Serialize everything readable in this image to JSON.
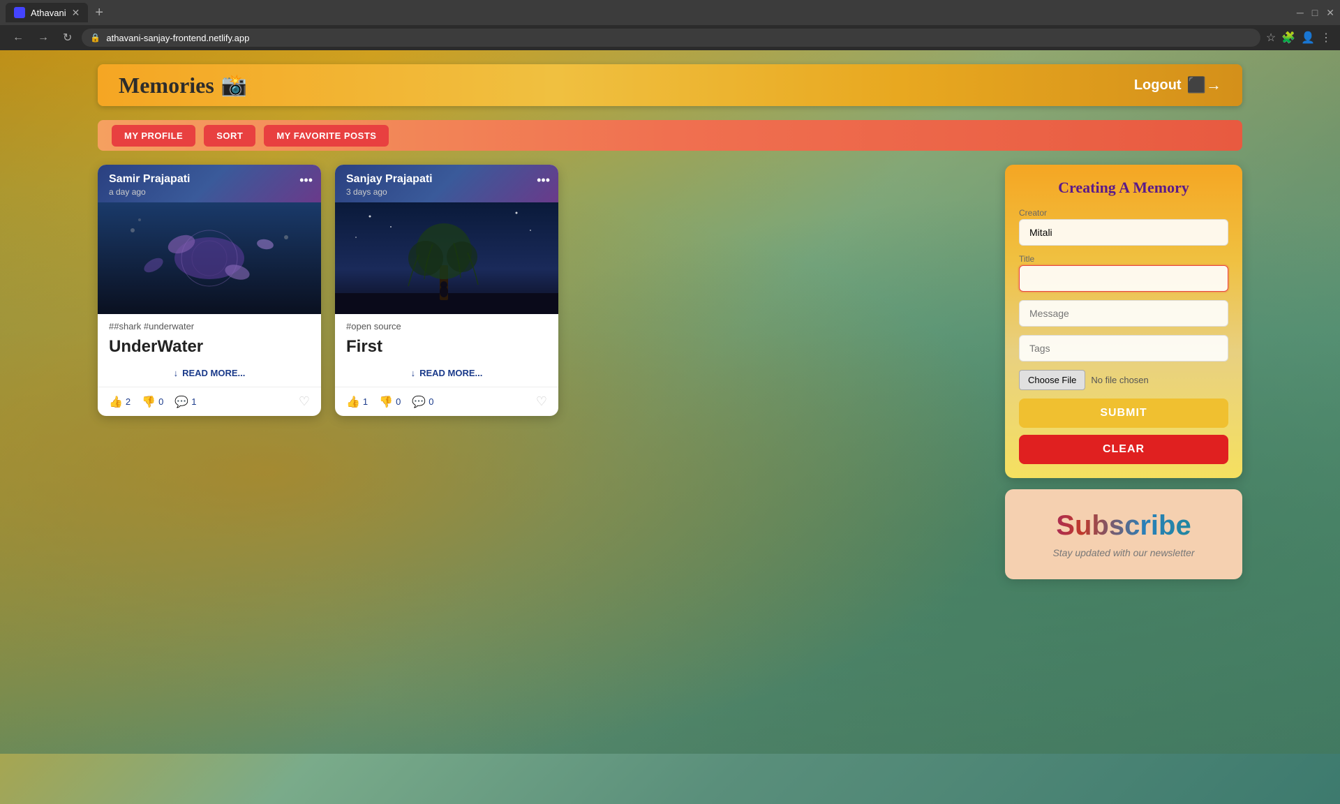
{
  "browser": {
    "tab_title": "Athavani",
    "url": "athavani-sanjay-frontend.netlify.app",
    "new_tab_label": "+"
  },
  "header": {
    "title": "Memories",
    "emoji": "📸",
    "logout_label": "Logout"
  },
  "nav": {
    "my_profile_label": "MY PROFILE",
    "sort_label": "SORT",
    "my_favorite_posts_label": "MY FAVORITE POSTS"
  },
  "posts": [
    {
      "author": "Samir Prajapati",
      "date": "a day ago",
      "tags": "##shark #underwater",
      "title": "UnderWater",
      "read_more": "READ MORE...",
      "likes": "2",
      "dislikes": "0",
      "comments": "1",
      "scene": "underwater"
    },
    {
      "author": "Sanjay Prajapati",
      "date": "3 days ago",
      "tags": "#open source",
      "title": "First",
      "read_more": "READ MORE...",
      "likes": "1",
      "dislikes": "0",
      "comments": "0",
      "scene": "tree"
    }
  ],
  "form": {
    "title_label": "Creating A Memory",
    "creator_label": "Creator",
    "creator_placeholder": "Mitali",
    "title_field_label": "Title",
    "title_placeholder": "",
    "message_placeholder": "Message",
    "tags_placeholder": "Tags",
    "choose_file_label": "Choose File",
    "no_file_chosen": "No file chosen",
    "submit_label": "SUBMIT",
    "clear_label": "CLEAR"
  },
  "subscribe": {
    "title": "Subscribe",
    "subtitle": "Stay updated with our newsletter"
  }
}
